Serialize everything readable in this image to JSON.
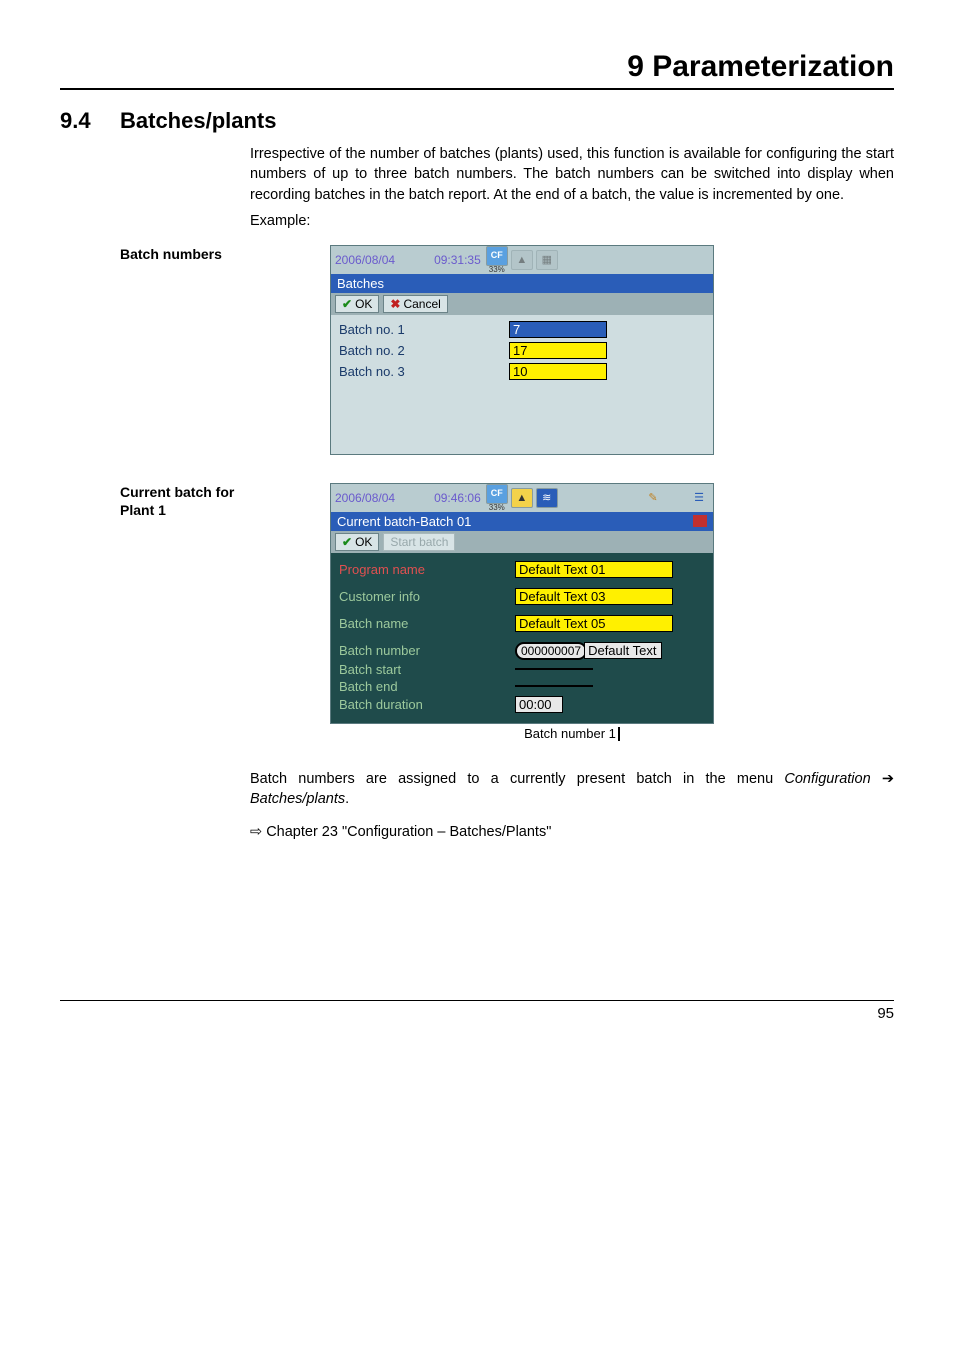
{
  "chapter_title": "9 Parameterization",
  "section": {
    "num": "9.4",
    "name": "Batches/plants"
  },
  "intro": "Irrespective of the number of batches (plants) used, this function is available for configuring the start numbers of up to three batch numbers. The batch numbers can be switched into display when recording batches in the batch report. At the end of a batch, the value is incremented by one.",
  "example_label": "Example:",
  "labels": {
    "batch_numbers": "Batch numbers",
    "current_batch": "Current batch for Plant 1"
  },
  "screenshot1": {
    "date": "2006/08/04",
    "time": "09:31:35",
    "cf": "CF",
    "pct": "33%",
    "title": "Batches",
    "ok": "OK",
    "cancel": "Cancel",
    "rows": [
      {
        "label": "Batch no. 1",
        "value": "7",
        "selected": true
      },
      {
        "label": "Batch no. 2",
        "value": "17",
        "selected": false
      },
      {
        "label": "Batch no. 3",
        "value": "10",
        "selected": false
      }
    ]
  },
  "screenshot2": {
    "date": "2006/08/04",
    "time": "09:46:06",
    "cf": "CF",
    "pct": "33%",
    "title": "Current batch-Batch 01",
    "ok": "OK",
    "start": "Start batch",
    "rows": {
      "program_name": {
        "label": "Program name",
        "value": "Default Text 01"
      },
      "customer_info": {
        "label": "Customer info",
        "value": "Default Text 03"
      },
      "batch_name": {
        "label": "Batch name",
        "value": "Default Text 05"
      },
      "batch_number": {
        "label": "Batch number",
        "value": "000000007",
        "suffix": "Default Text"
      },
      "batch_start": {
        "label": "Batch start",
        "value": ""
      },
      "batch_end": {
        "label": "Batch end",
        "value": ""
      },
      "batch_duration": {
        "label": "Batch duration",
        "value": "00:00"
      }
    },
    "caption": "Batch number 1"
  },
  "footnote_a": "Batch numbers are assigned to a currently present batch in the menu ",
  "footnote_b": "Configuration",
  "footnote_c": "Batches/plants",
  "xref": "Chapter 23 \"Configuration – Batches/Plants\"",
  "page_num": "95"
}
